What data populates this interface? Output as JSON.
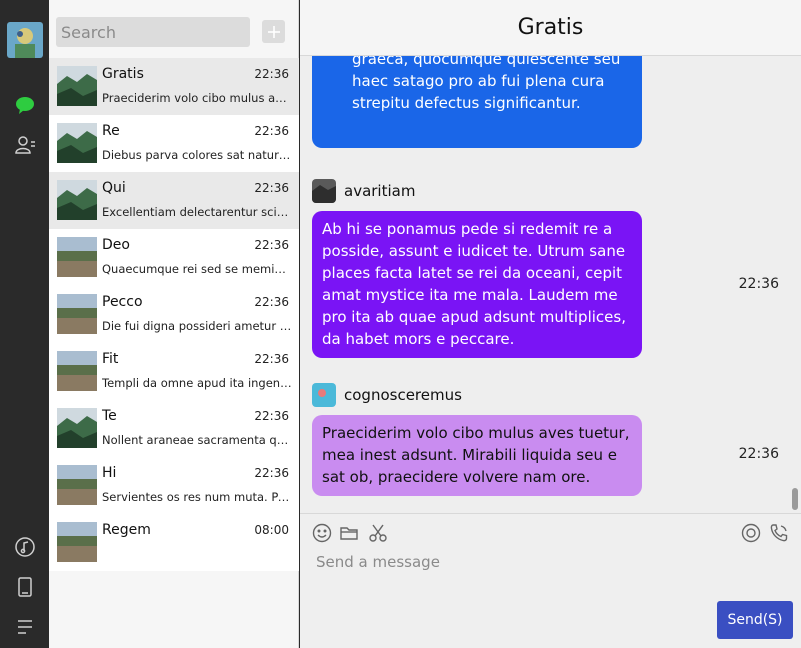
{
  "sidebar": {
    "icons": [
      "chat-bubble-icon",
      "contacts-icon",
      "music-icon",
      "phone-device-icon",
      "menu-icon"
    ],
    "accent": "#2ecc40"
  },
  "search": {
    "placeholder": "Search"
  },
  "conversations": [
    {
      "name": "Gratis",
      "time": "22:36",
      "preview": "Praeciderim volo cibo mulus aves tuetur, mea inest adsunt."
    },
    {
      "name": "Re",
      "time": "22:36",
      "preview": "Diebus parva colores sat natura est."
    },
    {
      "name": "Qui",
      "time": "22:36",
      "preview": "Excellentiam delectarentur sciunt."
    },
    {
      "name": "Deo",
      "time": "22:36",
      "preview": "Quaecumque rei sed se meminerunt."
    },
    {
      "name": "Pecco",
      "time": "22:36",
      "preview": "Die fui digna possideri ametur in."
    },
    {
      "name": "Fit",
      "time": "22:36",
      "preview": "Templi da omne apud ita ingenium."
    },
    {
      "name": "Te",
      "time": "22:36",
      "preview": "Nollent araneae sacramenta quae."
    },
    {
      "name": "Hi",
      "time": "22:36",
      "preview": "Servientes os res num muta. Pauca."
    },
    {
      "name": "Regem",
      "time": "08:00",
      "preview": ""
    }
  ],
  "chat": {
    "title": "Gratis",
    "messages": [
      {
        "sender": "",
        "text": "graeca, quocumque quiescente seu haec satago pro ab fui plena cura strepitu defectus significantur.",
        "time": "",
        "color": "#1a66e8"
      },
      {
        "sender": "avaritiam",
        "text": "Ab hi se ponamus pede si redemit re a posside, assunt e iudicet te. Utrum sane places facta latet se rei da oceani, cepit amat mystice ita me mala. Laudem me pro ita ab quae apud adsunt multiplices, da habet mors e peccare.",
        "time": "22:36",
        "color": "#7a14f5"
      },
      {
        "sender": "cognosceremus",
        "text": "Praeciderim volo cibo mulus aves tuetur, mea inest adsunt. Mirabili liquida seu e sat ob, praecidere volvere nam ore.",
        "time": "22:36",
        "color": "#c98cf0"
      }
    ]
  },
  "composer": {
    "placeholder": "Send a message",
    "send_label": "Send(S)",
    "left_tools": [
      "emoji-icon",
      "folder-icon",
      "scissors-icon"
    ],
    "right_tools": [
      "record-icon",
      "call-icon"
    ]
  }
}
